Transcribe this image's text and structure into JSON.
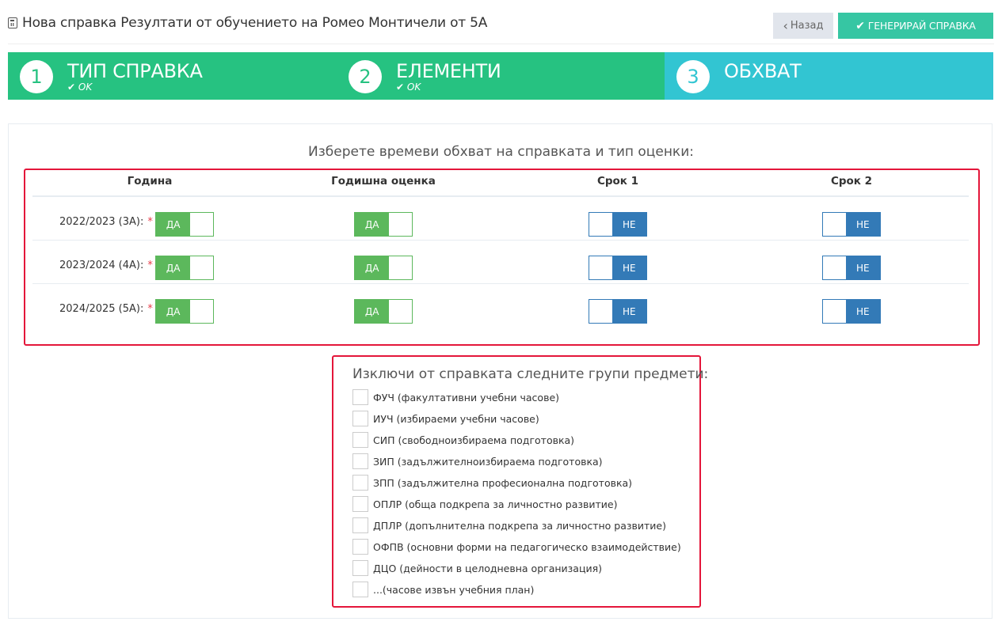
{
  "header": {
    "title": "Нова справка Резултати от обучението на Ромео Монтичели от 5А",
    "title_icon": "calculator-icon",
    "back_label": "Назад",
    "generate_label": "ГЕНЕРИРАЙ СПРАВКА"
  },
  "wizard": {
    "steps": [
      {
        "number": "1",
        "title": "ТИП СПРАВКА",
        "status": "OK",
        "state": "done"
      },
      {
        "number": "2",
        "title": "ЕЛЕМЕНТИ",
        "status": "OK",
        "state": "done"
      },
      {
        "number": "3",
        "title": "ОБХВАТ",
        "status": "",
        "state": "active"
      }
    ],
    "colors": {
      "done": "#26c281",
      "active": "#32c5d2"
    }
  },
  "scope": {
    "title": "Изберете времеви обхват на справката и тип оценки:",
    "columns": [
      "Година",
      "Годишна оценка",
      "Срок 1",
      "Срок 2"
    ],
    "rows": [
      {
        "year": "2022/2023 (3А):",
        "required": "*",
        "year_toggle": "ДА",
        "annual": "ДА",
        "term1": "НЕ",
        "term2": "НЕ"
      },
      {
        "year": "2023/2024 (4А):",
        "required": "*",
        "year_toggle": "ДА",
        "annual": "ДА",
        "term1": "НЕ",
        "term2": "НЕ"
      },
      {
        "year": "2024/2025 (5А):",
        "required": "*",
        "year_toggle": "ДА",
        "annual": "ДА",
        "term1": "НЕ",
        "term2": "НЕ"
      }
    ]
  },
  "exclude": {
    "title": "Изключи от справката следните групи предмети:",
    "items": [
      "ФУЧ (факултативни учебни часове)",
      "ИУЧ (избираеми учебни часове)",
      "СИП (свободноизбираема подготовка)",
      "ЗИП (задължителноизбираема подготовка)",
      "ЗПП (задължителна професионална подготовка)",
      "ОПЛР (обща подкрепа за личностно развитие)",
      "ДПЛР (допълнителна подкрепа за личностно развитие)",
      "ОФПВ (основни форми на педагогическо взаимодействие)",
      "ДЦО (дейности в целодневна организация)",
      "...(часове извън учебния план)"
    ]
  },
  "colors": {
    "toggle_on": "#5cb85c",
    "toggle_off": "#337ab7",
    "generate_button": "#36c6a3",
    "highlight_border": "#e4163a"
  }
}
